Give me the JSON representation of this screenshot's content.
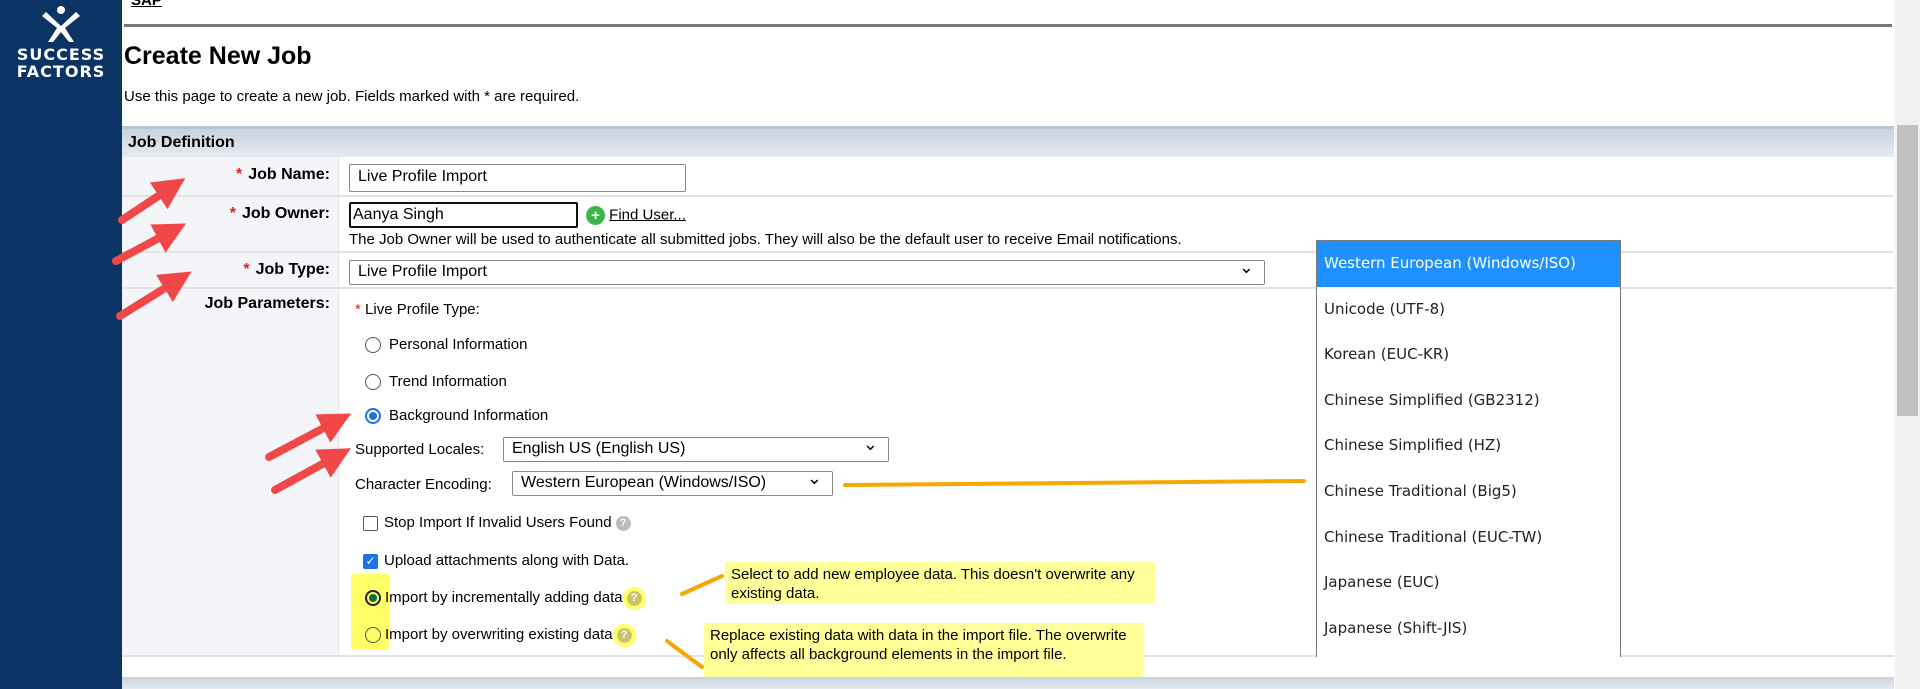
{
  "brand": {
    "line1": "SUCCESS",
    "line2": "FACTORS"
  },
  "breadcrumb_link": "SAP",
  "page": {
    "title": "Create New Job",
    "subtitle": "Use this page to create a new job. Fields marked with * are required."
  },
  "section": {
    "title": "Job Definition"
  },
  "form": {
    "required_mark": "*",
    "job_name": {
      "label": "Job Name:",
      "value": "Live Profile Import"
    },
    "job_owner": {
      "label": "Job Owner:",
      "value": "Aanya Singh",
      "find_user": "Find User...",
      "help": "The Job Owner will be used to authenticate all submitted jobs. They will also be the default user to receive Email notifications."
    },
    "job_type": {
      "label": "Job Type:",
      "value": "Live Profile Import"
    },
    "job_parameters": {
      "label": "Job Parameters:",
      "live_profile_type_label": "Live Profile Type:",
      "profile_types": [
        {
          "label": "Personal Information",
          "selected": false
        },
        {
          "label": "Trend Information",
          "selected": false
        },
        {
          "label": "Background Information",
          "selected": true
        }
      ],
      "supported_locales": {
        "label": "Supported Locales:",
        "value": "English US (English US)"
      },
      "character_encoding": {
        "label": "Character Encoding:",
        "value": "Western European (Windows/ISO)"
      },
      "stop_import": {
        "label": "Stop Import If Invalid Users Found",
        "checked": false
      },
      "upload_attachments": {
        "label": "Upload attachments along with Data.",
        "checked": true
      },
      "import_modes": [
        {
          "label": "Import by incrementally adding data",
          "selected": true
        },
        {
          "label": "Import by overwriting existing data",
          "selected": false
        }
      ]
    }
  },
  "callouts": {
    "incremental": "Select to add new employee data. This doesn't overwrite any existing data.",
    "overwrite": "Replace existing data with data in the import file. The overwrite only affects all background elements in the import file."
  },
  "encoding_options": [
    "Western European (Windows/ISO)",
    "Unicode (UTF-8)",
    "Korean (EUC-KR)",
    "Chinese Simplified (GB2312)",
    "Chinese Simplified (HZ)",
    "Chinese Traditional (Big5)",
    "Chinese Traditional (EUC-TW)",
    "Japanese (EUC)",
    "Japanese (Shift-JIS)"
  ],
  "colors": {
    "sidebar": "#0b3363",
    "accent": "#1e90ff",
    "annotation_arrow": "#f04848",
    "annotation_line": "#f5a800",
    "highlight": "#ffff66"
  }
}
